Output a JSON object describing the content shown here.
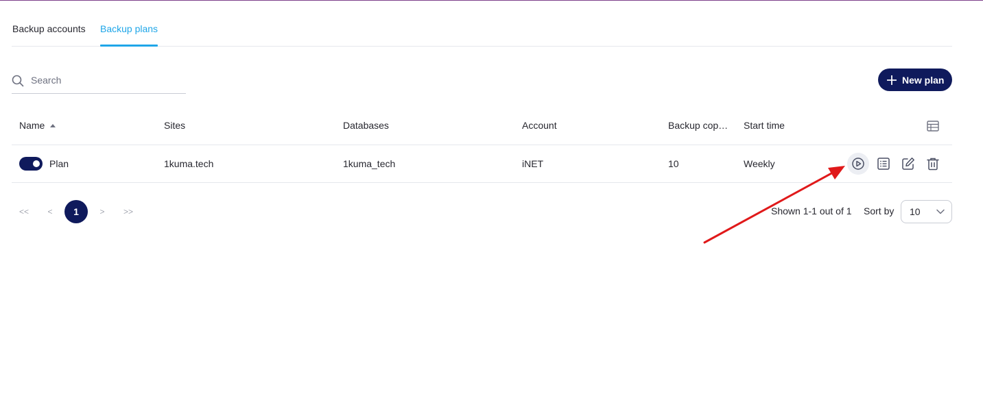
{
  "tabs": [
    {
      "label": "Backup accounts",
      "active": false
    },
    {
      "label": "Backup plans",
      "active": true
    }
  ],
  "search": {
    "placeholder": "Search",
    "value": ""
  },
  "new_plan_label": "New plan",
  "table": {
    "headers": {
      "name": "Name",
      "sites": "Sites",
      "databases": "Databases",
      "account": "Account",
      "backup_copies": "Backup copies",
      "start_time": "Start time"
    },
    "sort": {
      "column": "Name",
      "direction": "ascending"
    },
    "rows": [
      {
        "enabled": true,
        "name": "Plan",
        "sites": "1kuma.tech",
        "databases": "1kuma_tech",
        "account": "iNET",
        "backup_copies": "10",
        "start_time": "Weekly"
      }
    ],
    "row_actions": [
      "run-icon",
      "log-list-icon",
      "edit-icon",
      "trash-icon"
    ]
  },
  "pagination": {
    "first": "<<",
    "prev": "<",
    "current": "1",
    "next": ">",
    "last": ">>",
    "shown_text": "Shown 1-1 out of 1",
    "sort_by_label": "Sort by",
    "per_page": "10"
  },
  "colors": {
    "primary": "#0f1a5c",
    "tab_active": "#1fa6e8",
    "annotation_arrow": "#e0191a"
  }
}
